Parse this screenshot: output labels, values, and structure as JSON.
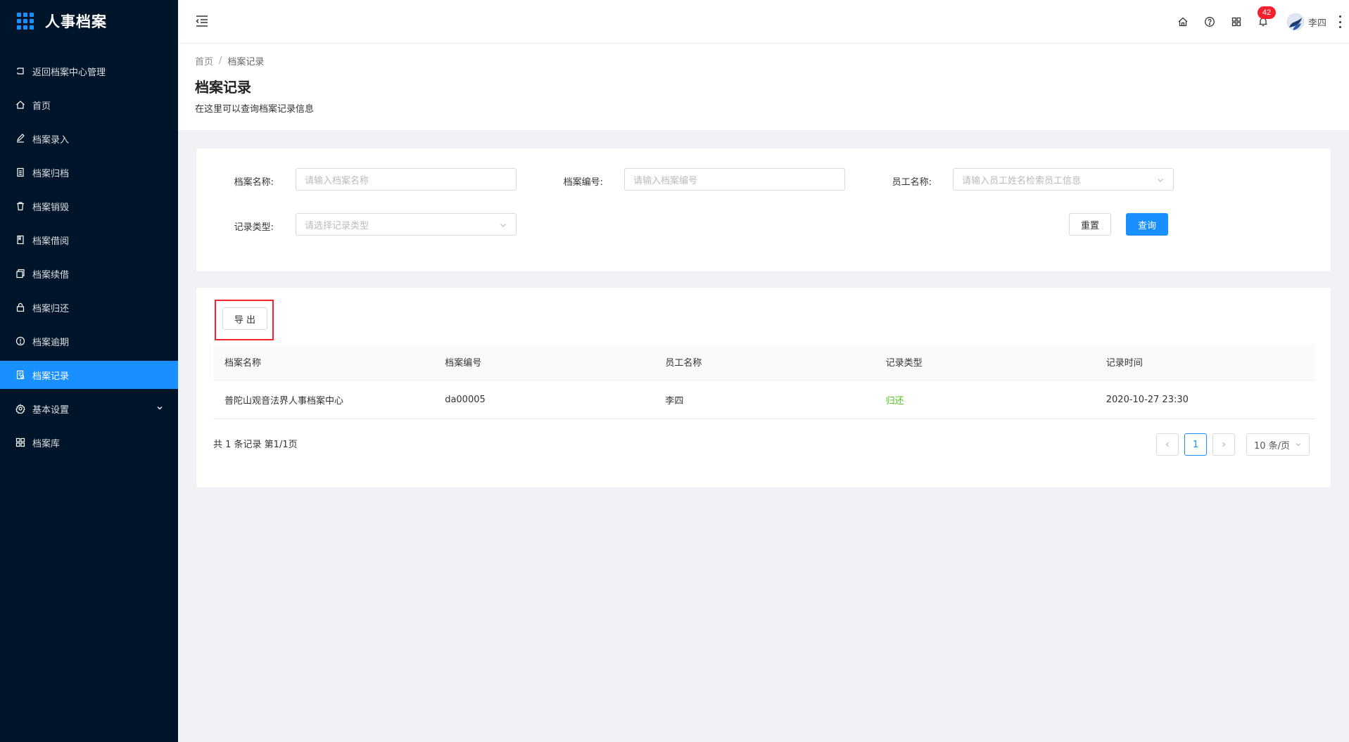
{
  "app": {
    "title": "人事档案"
  },
  "sidebar": {
    "items": [
      {
        "label": "返回档案中心管理",
        "icon": "return-icon"
      },
      {
        "label": "首页",
        "icon": "home-icon"
      },
      {
        "label": "档案录入",
        "icon": "edit-icon"
      },
      {
        "label": "档案归档",
        "icon": "file-icon"
      },
      {
        "label": "档案销毁",
        "icon": "delete-icon"
      },
      {
        "label": "档案借阅",
        "icon": "book-icon"
      },
      {
        "label": "档案续借",
        "icon": "copy-icon"
      },
      {
        "label": "档案归还",
        "icon": "lock-icon"
      },
      {
        "label": "档案逾期",
        "icon": "warning-icon"
      },
      {
        "label": "档案记录",
        "icon": "record-icon",
        "active": true
      },
      {
        "label": "基本设置",
        "icon": "gear-icon",
        "expandable": true
      },
      {
        "label": "档案库",
        "icon": "grid-icon"
      }
    ]
  },
  "header": {
    "notification_count": "42",
    "username": "李四"
  },
  "page": {
    "breadcrumb": [
      "首页",
      "档案记录"
    ],
    "breadcrumb_sep": "/",
    "title": "档案记录",
    "description": "在这里可以查询档案记录信息"
  },
  "search": {
    "name_label": "档案名称:",
    "name_placeholder": "请输入档案名称",
    "code_label": "档案编号:",
    "code_placeholder": "请输入档案编号",
    "employee_label": "员工名称:",
    "employee_placeholder": "请输入员工姓名检索员工信息",
    "type_label": "记录类型:",
    "type_placeholder": "请选择记录类型",
    "reset_label": "重置",
    "query_label": "查询"
  },
  "toolbar": {
    "export_label": "导 出"
  },
  "table": {
    "columns": [
      "档案名称",
      "档案编号",
      "员工名称",
      "记录类型",
      "记录时间"
    ],
    "rows": [
      [
        "普陀山观音法界人事档案中心",
        "da00005",
        "李四",
        "归还",
        "2020-10-27 23:30"
      ]
    ]
  },
  "pagination": {
    "total_text": "共 1 条记录 第1/1页",
    "current_page": "1",
    "page_size": "10 条/页"
  },
  "colors": {
    "sidebar_bg": "#001529",
    "primary": "#1890ff",
    "badge": "#f5222d",
    "success": "#52c41a"
  }
}
